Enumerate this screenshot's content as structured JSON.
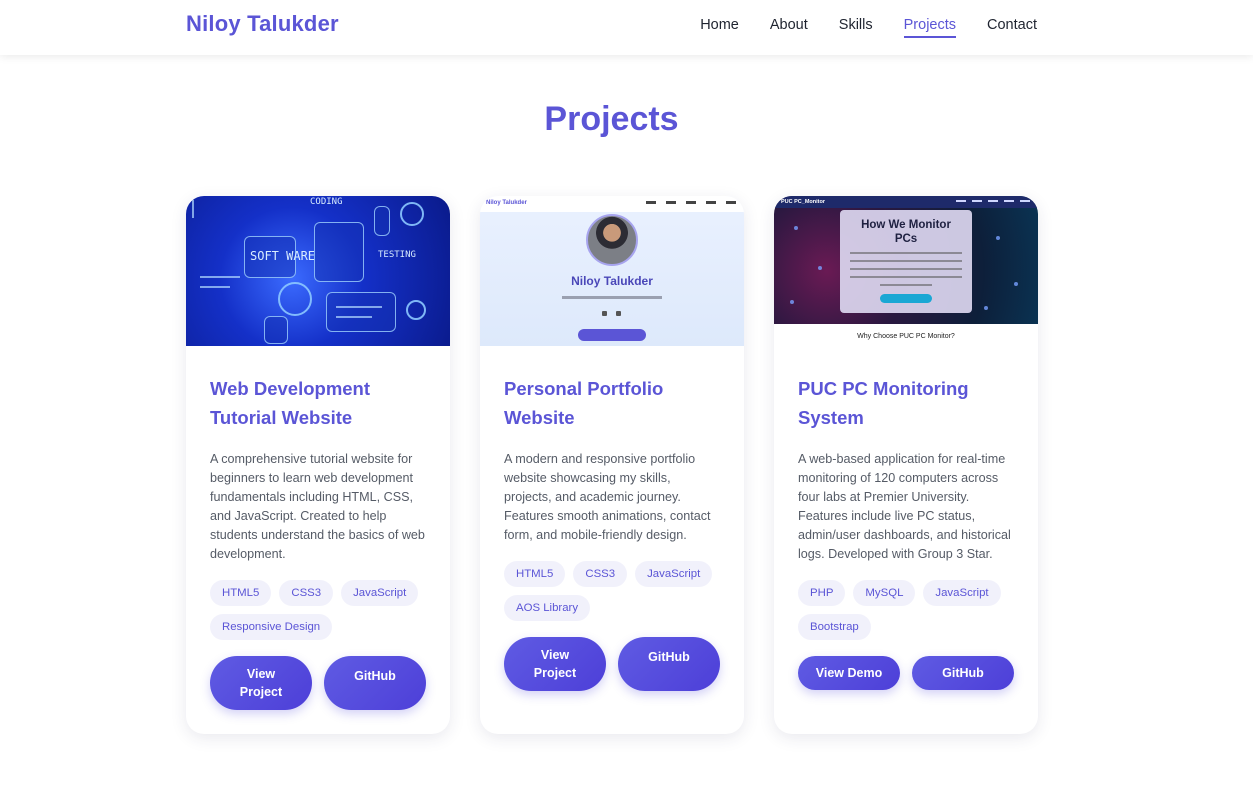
{
  "nav": {
    "brand": "Niloy Talukder",
    "links": [
      "Home",
      "About",
      "Skills",
      "Projects",
      "Contact"
    ],
    "active": "Projects"
  },
  "section": {
    "title": "Projects"
  },
  "projects": [
    {
      "title": "Web Development Tutorial Website",
      "description": "A comprehensive tutorial website for beginners to learn web development fundamentals including HTML, CSS, and JavaScript. Created to help students understand the basics of web development.",
      "tags": [
        "HTML5",
        "CSS3",
        "JavaScript",
        "Responsive Design"
      ],
      "buttons": [
        "View Project",
        "GitHub"
      ],
      "thumb_text": [
        "CODING",
        "SOFT WARE",
        "TESTING"
      ]
    },
    {
      "title": "Personal Portfolio Website",
      "description": "A modern and responsive portfolio website showcasing my skills, projects, and academic journey. Features smooth animations, contact form, and mobile-friendly design.",
      "tags": [
        "HTML5",
        "CSS3",
        "JavaScript",
        "AOS Library"
      ],
      "buttons": [
        "View Project",
        "GitHub"
      ],
      "thumb_text": [
        "Niloy Talukder",
        "Niloy Talukder"
      ]
    },
    {
      "title": "PUC PC Monitoring System",
      "description": "A web-based application for real-time monitoring of 120 computers across four labs at Premier University. Features include live PC status, admin/user dashboards, and historical logs. Developed with Group 3 Star.",
      "tags": [
        "PHP",
        "MySQL",
        "JavaScript",
        "Bootstrap"
      ],
      "buttons": [
        "View Demo",
        "GitHub"
      ],
      "thumb_text": [
        "PUC PC_Monitor",
        "How We Monitor PCs",
        "Why Choose PUC PC Monitor?"
      ]
    }
  ],
  "colors": {
    "accent": "#5b55d6",
    "text": "#1f2430",
    "muted": "#555b66",
    "tag_bg": "#f1f1fb"
  }
}
